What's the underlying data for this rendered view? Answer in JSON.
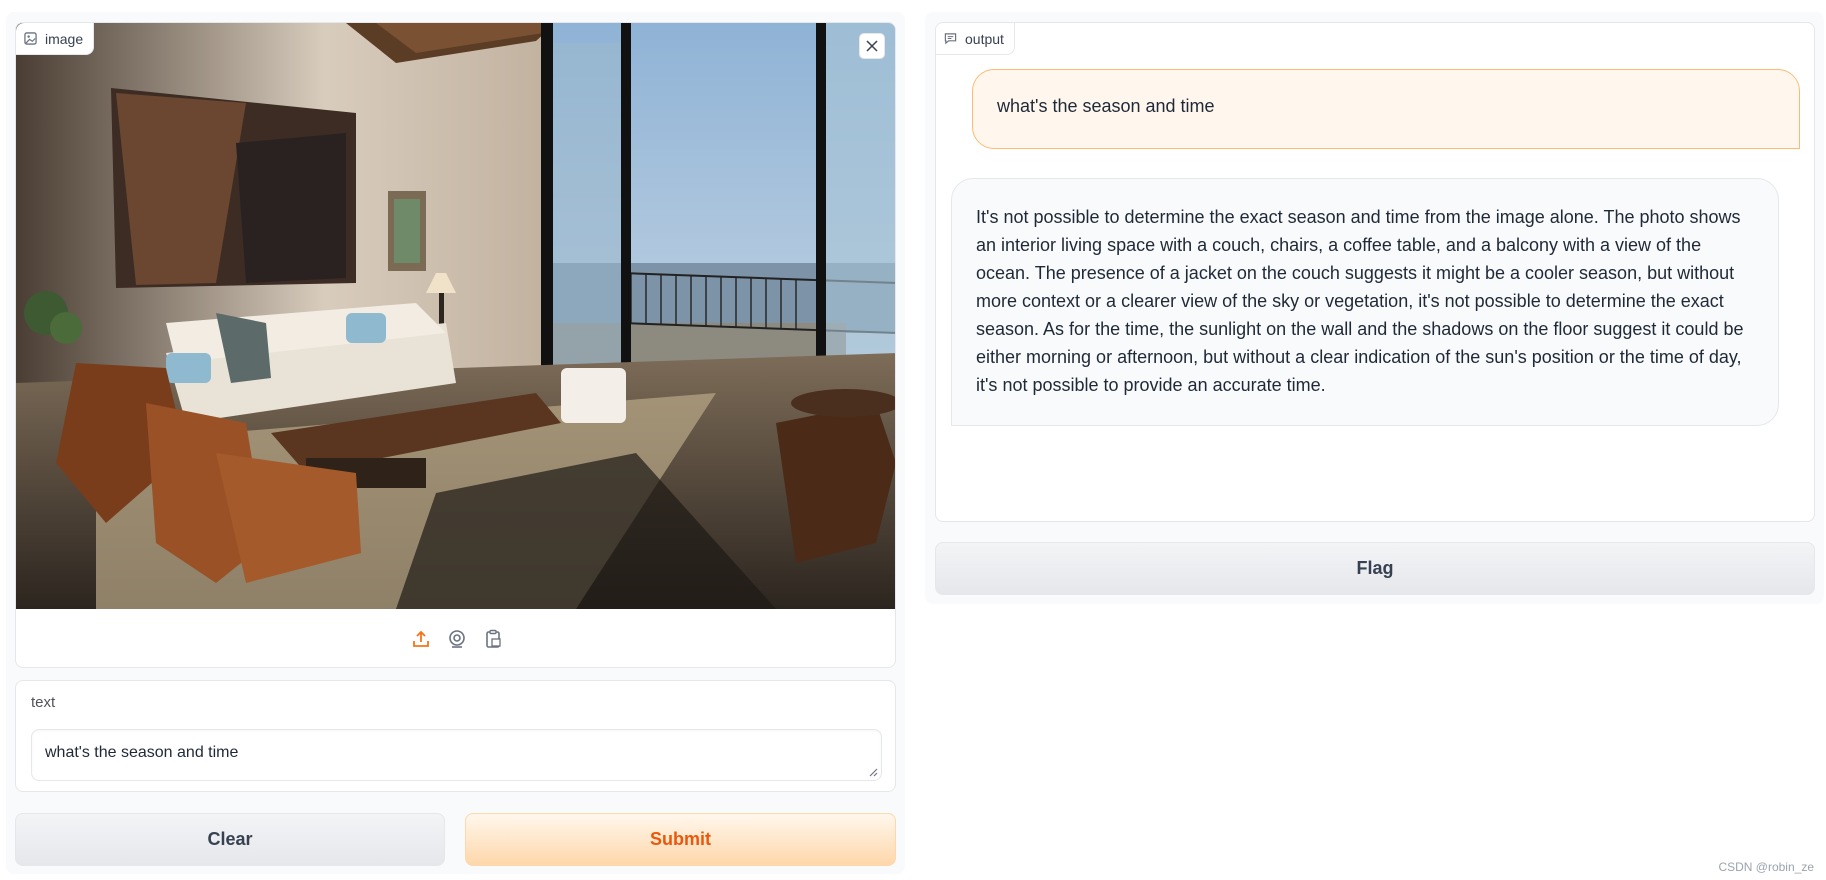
{
  "image_input": {
    "label": "image",
    "source_icons": [
      "upload-icon",
      "webcam-icon",
      "clipboard-icon"
    ]
  },
  "text_input": {
    "label": "text",
    "value": "what's the season and time"
  },
  "buttons": {
    "clear": "Clear",
    "submit": "Submit",
    "flag": "Flag"
  },
  "output": {
    "label": "output",
    "messages": [
      {
        "role": "user",
        "text": "what's the season and time"
      },
      {
        "role": "bot",
        "text": "It's not possible to determine the exact season and time from the image alone. The photo shows an interior living space with a couch, chairs, a coffee table, and a balcony with a view of the ocean. The presence of a jacket on the couch suggests it might be a cooler season, but without more context or a clearer view of the sky or vegetation, it's not possible to determine the exact season. As for the time, the sunlight on the wall and the shadows on the floor suggest it could be either morning or afternoon, but without a clear indication of the sun's position or the time of day, it's not possible to provide an accurate time."
      }
    ]
  },
  "watermark": "CSDN @robin_ze",
  "colors": {
    "accent": "#ea580c",
    "user_bubble": "#fff7ed",
    "user_border": "#fdba74"
  }
}
